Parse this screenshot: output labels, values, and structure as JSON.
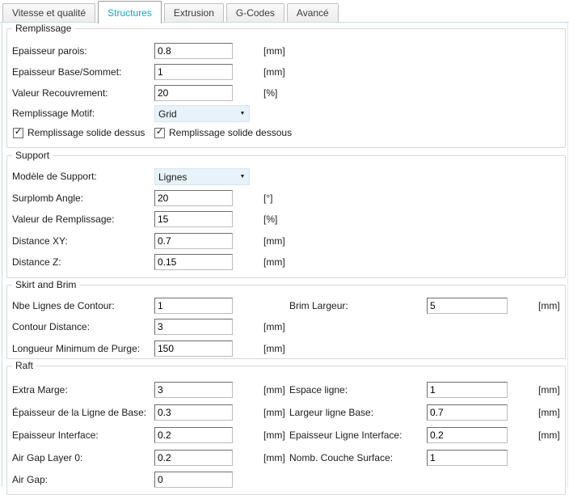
{
  "tabs": [
    {
      "label": "Vitesse et qualité"
    },
    {
      "label": "Structures"
    },
    {
      "label": "Extrusion"
    },
    {
      "label": "G-Codes"
    },
    {
      "label": "Avancé"
    }
  ],
  "active_tab": "Structures",
  "colors": {
    "active_tab_text": "#1d9fc4",
    "combo_bg": "#e7f2fa",
    "page_border": "#cfdae1",
    "group_border": "#d9d9d9"
  },
  "ui": {
    "dropdown_arrow": "▼"
  },
  "groups": {
    "remplissage": {
      "title": "Remplissage",
      "rows": [
        {
          "label": "Epaisseur parois:",
          "value": "0.8",
          "unit": "[mm]"
        },
        {
          "label": "Epaisseur Base/Sommet:",
          "value": "1",
          "unit": "[mm]"
        },
        {
          "label": "Valeur Recouvrement:",
          "value": "20",
          "unit": "[%]"
        },
        {
          "label": "Remplissage Motif:",
          "value": "Grid"
        }
      ],
      "checkboxes": [
        {
          "label": "Remplissage solide dessus",
          "checked": true,
          "glyph": "✓"
        },
        {
          "label": "Remplissage solide dessous",
          "checked": true,
          "glyph": "✓"
        }
      ]
    },
    "support": {
      "title": "Support",
      "rows": [
        {
          "label": "Modèle de Support:",
          "value": "Lignes"
        },
        {
          "label": "Surplomb Angle:",
          "value": "20",
          "unit": "[°]"
        },
        {
          "label": "Valeur de Remplissage:",
          "value": "15",
          "unit": "[%]"
        },
        {
          "label": "Distance XY:",
          "value": "0.7",
          "unit": "[mm]"
        },
        {
          "label": "Distance Z:",
          "value": "0.15",
          "unit": "[mm]"
        }
      ]
    },
    "skirt_and_brim": {
      "title": "Skirt and Brim",
      "rows_left": [
        {
          "label": "Nbe Lignes de Contour:",
          "value": "1",
          "unit": ""
        },
        {
          "label": "Contour Distance:",
          "value": "3",
          "unit": "[mm]"
        },
        {
          "label": "Longueur Minimum de Purge:",
          "value": "150",
          "unit": "[mm]"
        }
      ],
      "rows_right": [
        {
          "label": "Brim Largeur:",
          "value": "5",
          "unit": "[mm]"
        }
      ]
    },
    "raft": {
      "title": "Raft",
      "rows_left": [
        {
          "label": "Extra Marge:",
          "value": "3",
          "unit": "[mm]"
        },
        {
          "label": "Épaisseur de la Ligne de Base:",
          "value": "0.3",
          "unit": "[mm]"
        },
        {
          "label": "Epaisseur Interface:",
          "value": "0.2",
          "unit": "[mm]"
        },
        {
          "label": "Air Gap Layer 0:",
          "value": "0.2",
          "unit": "[mm]"
        },
        {
          "label": "Air Gap:",
          "value": "0",
          "unit": ""
        }
      ],
      "rows_right": [
        {
          "label": "Espace ligne:",
          "value": "1",
          "unit": "[mm]"
        },
        {
          "label": "Largeur ligne Base:",
          "value": "0.7",
          "unit": "[mm]"
        },
        {
          "label": "Epaisseur Ligne Interface:",
          "value": "0.2",
          "unit": "[mm]"
        },
        {
          "label": "Nomb. Couche Surface:",
          "value": "1",
          "unit": ""
        }
      ]
    }
  }
}
